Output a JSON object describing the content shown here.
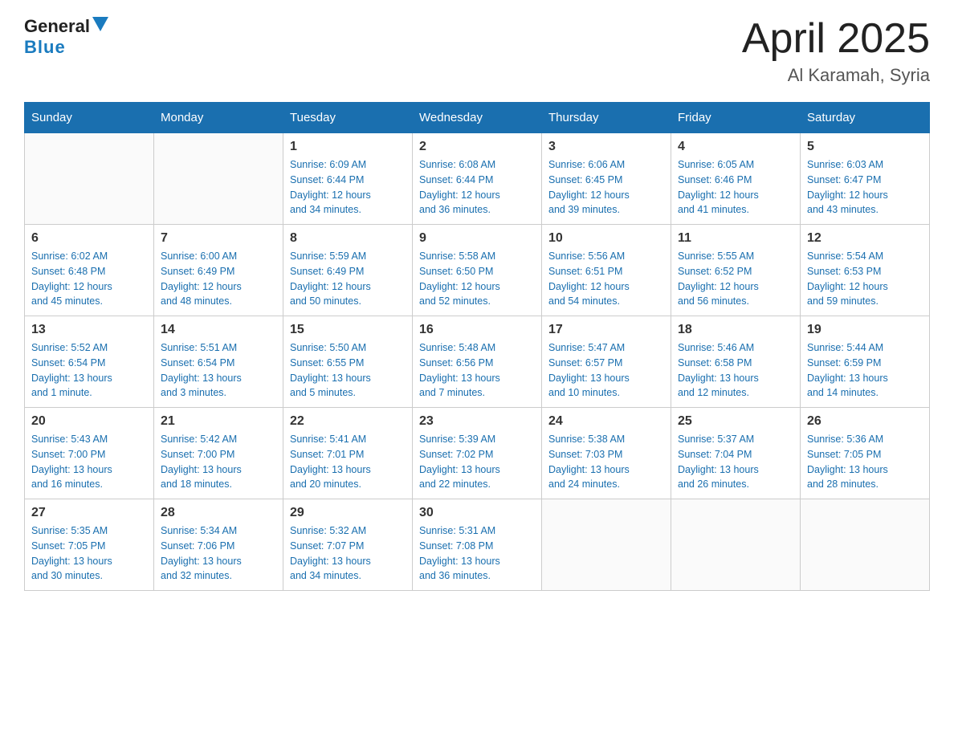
{
  "header": {
    "logo_general": "General",
    "logo_blue": "Blue",
    "title": "April 2025",
    "subtitle": "Al Karamah, Syria"
  },
  "weekdays": [
    "Sunday",
    "Monday",
    "Tuesday",
    "Wednesday",
    "Thursday",
    "Friday",
    "Saturday"
  ],
  "weeks": [
    [
      {
        "day": "",
        "info": ""
      },
      {
        "day": "",
        "info": ""
      },
      {
        "day": "1",
        "info": "Sunrise: 6:09 AM\nSunset: 6:44 PM\nDaylight: 12 hours\nand 34 minutes."
      },
      {
        "day": "2",
        "info": "Sunrise: 6:08 AM\nSunset: 6:44 PM\nDaylight: 12 hours\nand 36 minutes."
      },
      {
        "day": "3",
        "info": "Sunrise: 6:06 AM\nSunset: 6:45 PM\nDaylight: 12 hours\nand 39 minutes."
      },
      {
        "day": "4",
        "info": "Sunrise: 6:05 AM\nSunset: 6:46 PM\nDaylight: 12 hours\nand 41 minutes."
      },
      {
        "day": "5",
        "info": "Sunrise: 6:03 AM\nSunset: 6:47 PM\nDaylight: 12 hours\nand 43 minutes."
      }
    ],
    [
      {
        "day": "6",
        "info": "Sunrise: 6:02 AM\nSunset: 6:48 PM\nDaylight: 12 hours\nand 45 minutes."
      },
      {
        "day": "7",
        "info": "Sunrise: 6:00 AM\nSunset: 6:49 PM\nDaylight: 12 hours\nand 48 minutes."
      },
      {
        "day": "8",
        "info": "Sunrise: 5:59 AM\nSunset: 6:49 PM\nDaylight: 12 hours\nand 50 minutes."
      },
      {
        "day": "9",
        "info": "Sunrise: 5:58 AM\nSunset: 6:50 PM\nDaylight: 12 hours\nand 52 minutes."
      },
      {
        "day": "10",
        "info": "Sunrise: 5:56 AM\nSunset: 6:51 PM\nDaylight: 12 hours\nand 54 minutes."
      },
      {
        "day": "11",
        "info": "Sunrise: 5:55 AM\nSunset: 6:52 PM\nDaylight: 12 hours\nand 56 minutes."
      },
      {
        "day": "12",
        "info": "Sunrise: 5:54 AM\nSunset: 6:53 PM\nDaylight: 12 hours\nand 59 minutes."
      }
    ],
    [
      {
        "day": "13",
        "info": "Sunrise: 5:52 AM\nSunset: 6:54 PM\nDaylight: 13 hours\nand 1 minute."
      },
      {
        "day": "14",
        "info": "Sunrise: 5:51 AM\nSunset: 6:54 PM\nDaylight: 13 hours\nand 3 minutes."
      },
      {
        "day": "15",
        "info": "Sunrise: 5:50 AM\nSunset: 6:55 PM\nDaylight: 13 hours\nand 5 minutes."
      },
      {
        "day": "16",
        "info": "Sunrise: 5:48 AM\nSunset: 6:56 PM\nDaylight: 13 hours\nand 7 minutes."
      },
      {
        "day": "17",
        "info": "Sunrise: 5:47 AM\nSunset: 6:57 PM\nDaylight: 13 hours\nand 10 minutes."
      },
      {
        "day": "18",
        "info": "Sunrise: 5:46 AM\nSunset: 6:58 PM\nDaylight: 13 hours\nand 12 minutes."
      },
      {
        "day": "19",
        "info": "Sunrise: 5:44 AM\nSunset: 6:59 PM\nDaylight: 13 hours\nand 14 minutes."
      }
    ],
    [
      {
        "day": "20",
        "info": "Sunrise: 5:43 AM\nSunset: 7:00 PM\nDaylight: 13 hours\nand 16 minutes."
      },
      {
        "day": "21",
        "info": "Sunrise: 5:42 AM\nSunset: 7:00 PM\nDaylight: 13 hours\nand 18 minutes."
      },
      {
        "day": "22",
        "info": "Sunrise: 5:41 AM\nSunset: 7:01 PM\nDaylight: 13 hours\nand 20 minutes."
      },
      {
        "day": "23",
        "info": "Sunrise: 5:39 AM\nSunset: 7:02 PM\nDaylight: 13 hours\nand 22 minutes."
      },
      {
        "day": "24",
        "info": "Sunrise: 5:38 AM\nSunset: 7:03 PM\nDaylight: 13 hours\nand 24 minutes."
      },
      {
        "day": "25",
        "info": "Sunrise: 5:37 AM\nSunset: 7:04 PM\nDaylight: 13 hours\nand 26 minutes."
      },
      {
        "day": "26",
        "info": "Sunrise: 5:36 AM\nSunset: 7:05 PM\nDaylight: 13 hours\nand 28 minutes."
      }
    ],
    [
      {
        "day": "27",
        "info": "Sunrise: 5:35 AM\nSunset: 7:05 PM\nDaylight: 13 hours\nand 30 minutes."
      },
      {
        "day": "28",
        "info": "Sunrise: 5:34 AM\nSunset: 7:06 PM\nDaylight: 13 hours\nand 32 minutes."
      },
      {
        "day": "29",
        "info": "Sunrise: 5:32 AM\nSunset: 7:07 PM\nDaylight: 13 hours\nand 34 minutes."
      },
      {
        "day": "30",
        "info": "Sunrise: 5:31 AM\nSunset: 7:08 PM\nDaylight: 13 hours\nand 36 minutes."
      },
      {
        "day": "",
        "info": ""
      },
      {
        "day": "",
        "info": ""
      },
      {
        "day": "",
        "info": ""
      }
    ]
  ],
  "colors": {
    "header_bg": "#1a6faf",
    "accent_blue": "#1a6faf",
    "border": "#aaa"
  }
}
